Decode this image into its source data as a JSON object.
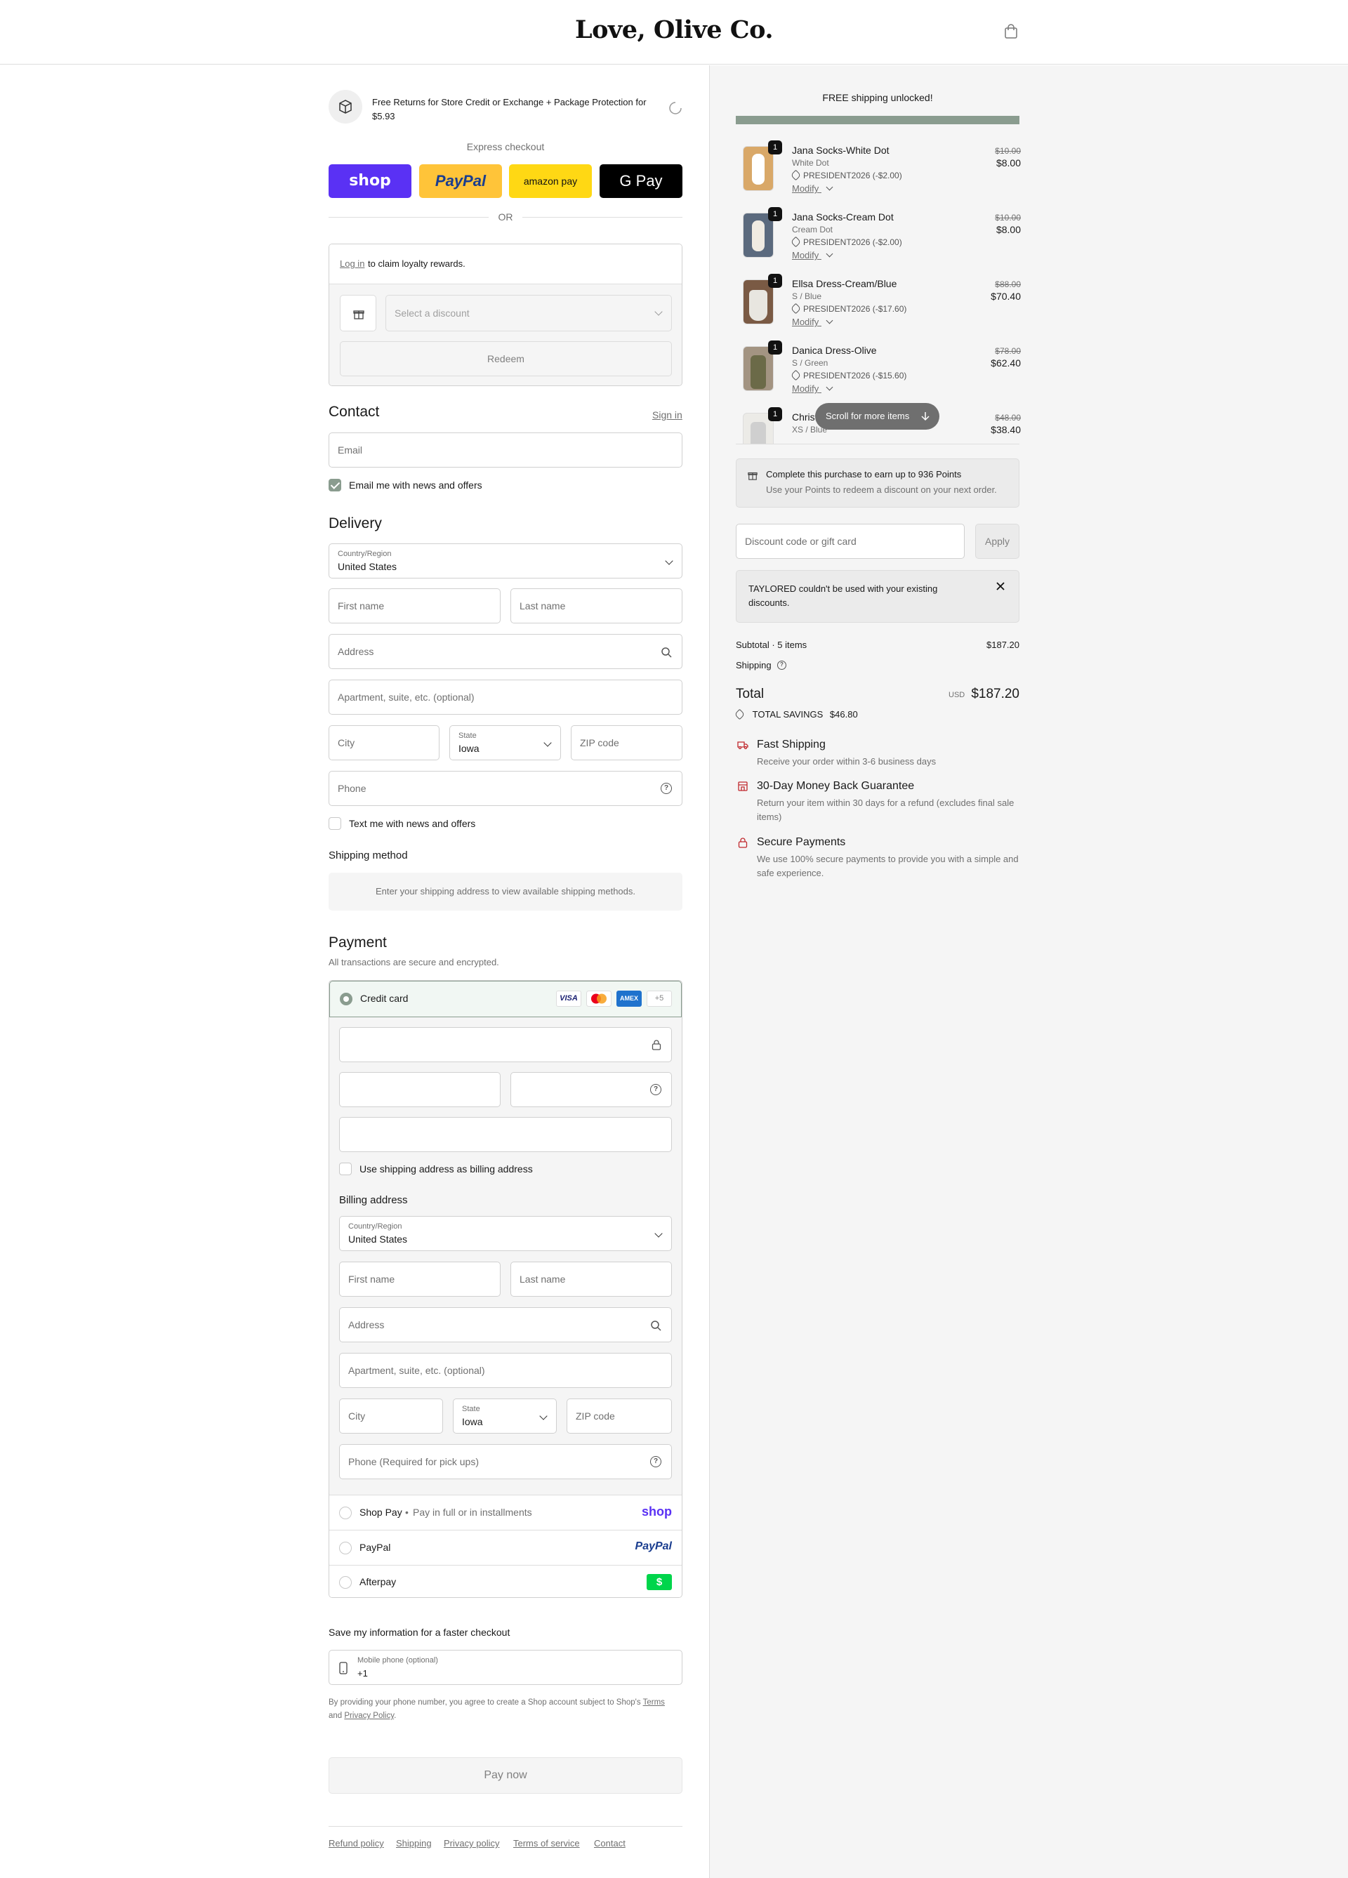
{
  "header": {
    "brand": "Love, Olive Co."
  },
  "protection": {
    "text": "Free Returns for Store Credit or Exchange + Package Protection for $5.93"
  },
  "express": {
    "title": "Express checkout",
    "shop": "shop",
    "paypal": "PayPal",
    "amazon": "amazon pay",
    "gpay": "G Pay",
    "or": "OR"
  },
  "loyalty": {
    "login": "Log in",
    "text": "to claim loyalty rewards.",
    "select_placeholder": "Select a discount",
    "redeem": "Redeem"
  },
  "contact": {
    "title": "Contact",
    "signin": "Sign in",
    "email_placeholder": "Email",
    "news": "Email me with news and offers"
  },
  "delivery": {
    "title": "Delivery",
    "country_label": "Country/Region",
    "country": "United States",
    "first": "First name",
    "last": "Last name",
    "address": "Address",
    "apt": "Apartment, suite, etc. (optional)",
    "city": "City",
    "state_label": "State",
    "state": "Iowa",
    "zip": "ZIP code",
    "phone": "Phone",
    "text_news": "Text me with news and offers"
  },
  "shipping": {
    "title": "Shipping method",
    "note": "Enter your shipping address to view available shipping methods."
  },
  "payment": {
    "title": "Payment",
    "subtitle": "All transactions are secure and encrypted.",
    "credit": "Credit card",
    "more": "+5",
    "use_shipping": "Use shipping address as billing address",
    "billing_title": "Billing address",
    "country_label": "Country/Region",
    "country": "United States",
    "first": "First name",
    "last": "Last name",
    "address": "Address",
    "apt": "Apartment, suite, etc. (optional)",
    "city": "City",
    "state_label": "State",
    "state": "Iowa",
    "zip": "ZIP code",
    "phone": "Phone (Required for pick ups)",
    "shoppay": "Shop Pay",
    "shoppay_note": "Pay in full or in installments",
    "shoppay_logo": "shop",
    "paypal": "PayPal",
    "paypal_logo": "PayPal",
    "afterpay": "Afterpay"
  },
  "save": {
    "title": "Save my information for a faster checkout",
    "mobile_label": "Mobile phone (optional)",
    "mobile_value": "+1",
    "legal1": "By providing your phone number, you agree to create a Shop account subject to Shop's",
    "terms": "Terms",
    "and": "and",
    "privacy": "Privacy Policy",
    "paynow": "Pay now"
  },
  "footer": {
    "refund": "Refund policy",
    "shipping": "Shipping",
    "privacy": "Privacy policy",
    "terms": "Terms of service",
    "contact": "Contact"
  },
  "summary": {
    "free_ship": "FREE shipping unlocked!",
    "items": [
      {
        "qty": "1",
        "name": "Jana Socks-White Dot",
        "variant": "White Dot",
        "code": "PRESIDENT2026 (-$2.00)",
        "modify": "Modify",
        "old": "$10.00",
        "price": "$8.00"
      },
      {
        "qty": "1",
        "name": "Jana Socks-Cream Dot",
        "variant": "Cream Dot",
        "code": "PRESIDENT2026 (-$2.00)",
        "modify": "Modify",
        "old": "$10.00",
        "price": "$8.00"
      },
      {
        "qty": "1",
        "name": "Ellsa Dress-Cream/Blue",
        "variant": "S / Blue",
        "code": "PRESIDENT2026 (-$17.60)",
        "modify": "Modify",
        "old": "$88.00",
        "price": "$70.40"
      },
      {
        "qty": "1",
        "name": "Danica Dress-Olive",
        "variant": "S / Green",
        "code": "PRESIDENT2026 (-$15.60)",
        "modify": "Modify",
        "old": "$78.00",
        "price": "$62.40"
      },
      {
        "qty": "1",
        "name": "Christ",
        "variant": "XS / Blue",
        "code": "",
        "modify": "",
        "old": "$48.00",
        "price": "$38.40"
      }
    ],
    "scroll_more": "Scroll for more items",
    "points_title": "Complete this purchase to earn up to 936 Points",
    "points_desc": "Use your Points to redeem a discount on your next order.",
    "discount_placeholder": "Discount code or gift card",
    "apply": "Apply",
    "error": "TAYLORED couldn't be used with your existing discounts.",
    "subtotal_label": "Subtotal · 5 items",
    "subtotal": "$187.20",
    "shipping_label": "Shipping",
    "total_label": "Total",
    "currency": "USD",
    "total": "$187.20",
    "savings_label": "TOTAL SAVINGS",
    "savings": "$46.80",
    "features": [
      {
        "title": "Fast Shipping",
        "desc": "Receive your order within 3-6 business days"
      },
      {
        "title": "30-Day Money Back Guarantee",
        "desc": "Return your item within 30 days for a refund (excludes final sale items)"
      },
      {
        "title": "Secure Payments",
        "desc": "We use 100% secure payments to provide you with a simple and safe experience."
      }
    ]
  },
  "colors": {
    "shop": "#5a31f4",
    "paypal": "#ffc439",
    "amazon": "#ffd814",
    "gpay": "#000000",
    "accent_red": "#c0282d",
    "progress": "#8a9c8f"
  }
}
